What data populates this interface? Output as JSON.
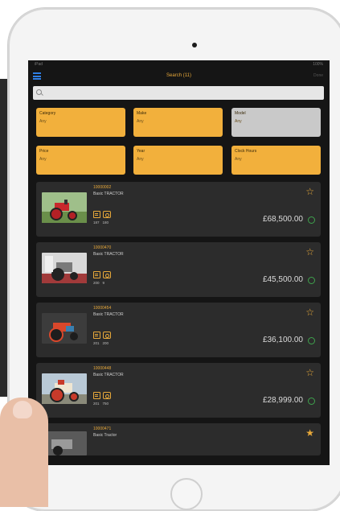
{
  "navbar": {
    "title": "Search (11)",
    "right_label": "Done",
    "status_left": "iPad",
    "status_right": "100%"
  },
  "search": {
    "placeholder": ""
  },
  "filters": [
    {
      "label": "Category",
      "value": "Any"
    },
    {
      "label": "Make",
      "value": "Any"
    },
    {
      "label": "Model",
      "value": "Any"
    },
    {
      "label": "Price",
      "value": "Any"
    },
    {
      "label": "Year",
      "value": "Any"
    },
    {
      "label": "Clock Hours",
      "value": "Any"
    }
  ],
  "listings": [
    {
      "lot": "10000002",
      "name": "Basic TRACTOR",
      "year": "187",
      "hours": "180",
      "price": "£68,500.00",
      "favorite": false
    },
    {
      "lot": "10000470",
      "name": "Basic TRACTOR",
      "year": "200",
      "hours": "9",
      "price": "£45,500.00",
      "favorite": false
    },
    {
      "lot": "10000454",
      "name": "Basic TRACTOR",
      "year": "201",
      "hours": "200",
      "price": "£36,100.00",
      "favorite": false
    },
    {
      "lot": "10000448",
      "name": "Basic TRACTOR",
      "year": "201",
      "hours": "750",
      "price": "£28,999.00",
      "favorite": false
    },
    {
      "lot": "10000471",
      "name": "Basic Tractor",
      "year": "",
      "hours": "",
      "price": "",
      "favorite": true
    }
  ],
  "colors": {
    "accent": "#e8a93a",
    "card": "#2c2c2c",
    "screen": "#151515",
    "status_ok": "#3fa34d",
    "menu": "#2f7fe4"
  },
  "icons": {
    "menu": "menu-icon",
    "search": "search-icon",
    "calendar": "calendar-icon",
    "hours": "clock-hours-icon",
    "favorite": "star-icon",
    "status": "status-circle-icon"
  }
}
